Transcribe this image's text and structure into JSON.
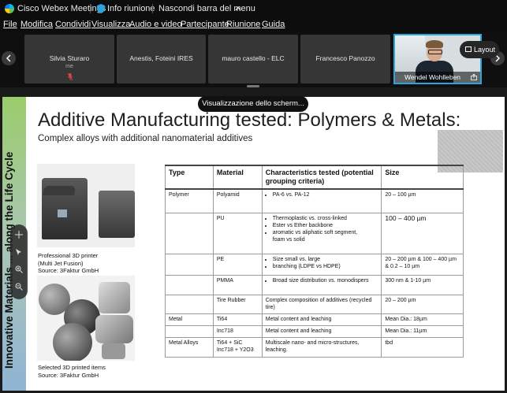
{
  "titlebar": {
    "app_name": "Cisco Webex Meetings",
    "info_label": "Info riunione",
    "hide_menu_label": "Nascondi barra del menu"
  },
  "menu": [
    "File",
    "Modifica",
    "Condividi",
    "Visualizza",
    "Audio e video",
    "Partecipante",
    "Riunione",
    "Guida"
  ],
  "participants": [
    {
      "name": "Silvia Sturaro",
      "sub": "me"
    },
    {
      "name": "Anestis, Foteini IRES",
      "sub": ""
    },
    {
      "name": "mauro castello - ELC",
      "sub": ""
    },
    {
      "name": "Francesco Panozzo",
      "sub": ""
    }
  ],
  "active_speaker": "Wendel Wohlleben",
  "layout_label": "Layout",
  "share_label": "Visualizzazione dello scherm...",
  "slide": {
    "title": "Additive Manufacturing tested: Polymers & Metals:",
    "subtitle": "Complex alloys with additional nanomaterial additives",
    "side_text": "Innovative Materials ... along the Life Cycle",
    "caption1": [
      "Professional 3D printer",
      "(Multi Jet Fusion)",
      "Source: 3Faktur GmbH"
    ],
    "caption2": [
      "Selected 3D printed items",
      "Source: 3Faktur GmbH"
    ],
    "table": {
      "headers": [
        "Type",
        "Material",
        "Characteristics tested (potential grouping criteria)",
        "Size"
      ],
      "rows": [
        {
          "type": "Polymer",
          "material": "Polyamid",
          "chars": [
            "PA-6 vs. PA-12"
          ],
          "size": "20 – 100 µm"
        },
        {
          "type": "",
          "material": "PU",
          "chars": [
            "Thermoplastic vs. cross-linked",
            "Ester vs Ether backbone",
            "aromatic vs aliphatic soft segment,",
            "foam vs solid"
          ],
          "size": "100 – 400 µm"
        },
        {
          "type": "",
          "material": "PE",
          "chars": [
            "Size small vs. large",
            "branching (LDPE vs HDPE)"
          ],
          "size": "20 – 200 µm & 100 – 400 µm & 0.2 – 10 µm"
        },
        {
          "type": "",
          "material": "PMMA",
          "chars": [
            "Broad size distribution vs. monodispers"
          ],
          "size": "300 nm & 1-10 µm"
        },
        {
          "type": "",
          "material": "Tire Rubber",
          "text": "Complex composition of additives (recycled tire)",
          "size": "20 – 200 µm"
        },
        {
          "type": "Metal",
          "material": "Ti64",
          "text": "Metal content and leaching",
          "size": "Mean Dia.: 18µm"
        },
        {
          "type": "",
          "material": "Inc718",
          "text": "Metal content and leaching",
          "size": "Mean Dia.: 11µm"
        },
        {
          "type": "Metal Alloys",
          "material": "Ti64 + SiC Inc718 + Y2O3",
          "text": "Multiscale nano- and micro-structures, leaching.",
          "size": "tbd"
        }
      ]
    }
  },
  "colors": {
    "accent": "#2ea4dd",
    "tile": "#363636",
    "mute": "#e5484d"
  }
}
